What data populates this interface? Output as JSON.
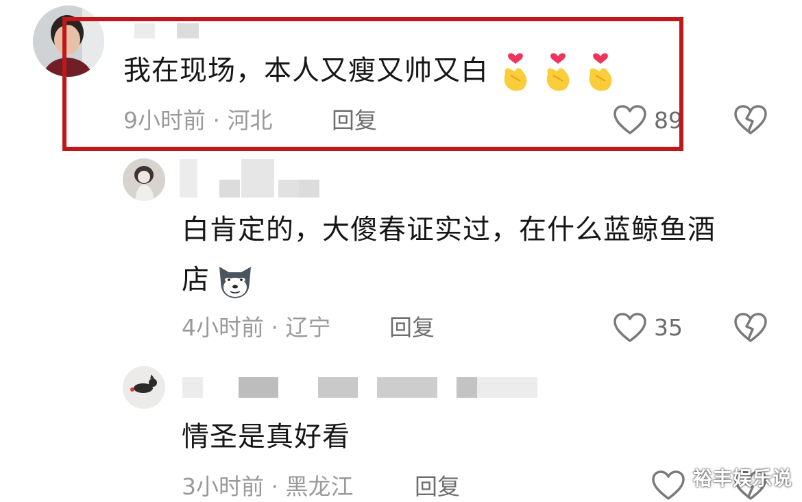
{
  "comments": [
    {
      "text": "我在现场，本人又瘦又帅又白",
      "emoji": [
        "finger-heart-emoji",
        "finger-heart-emoji",
        "finger-heart-emoji"
      ],
      "time_location": "9小时前 · 河北",
      "reply_label": "回复",
      "likes": "89"
    },
    {
      "text_line1": "白肯定的，大傻春证实过，在什么蓝鲸鱼酒",
      "text_line2": "店",
      "emoji": [
        "wolf-face-emoji"
      ],
      "time_location": "4小时前 · 辽宁",
      "reply_label": "回复",
      "likes": "35"
    },
    {
      "text": "情圣是真好看",
      "time_location": "3小时前 · 黑龙江",
      "reply_label": "回复",
      "likes": ""
    }
  ],
  "watermark": "裕丰娱乐说",
  "colors": {
    "highlight": "#c0171a",
    "text": "#161616",
    "meta": "#9a9a9a"
  }
}
